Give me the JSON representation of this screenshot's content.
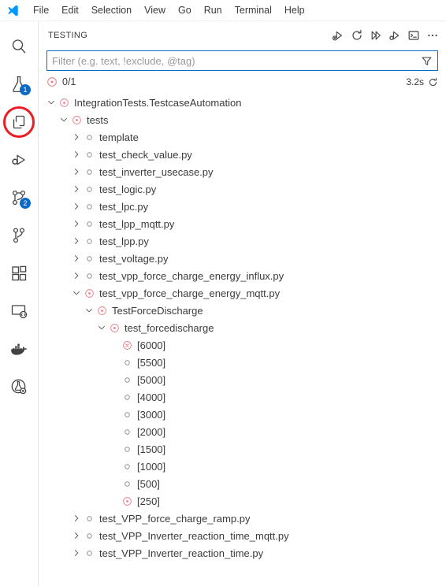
{
  "menubar": {
    "logo_icon": "vscode-logo",
    "items": [
      {
        "label": "File"
      },
      {
        "label": "Edit"
      },
      {
        "label": "Selection"
      },
      {
        "label": "View"
      },
      {
        "label": "Go"
      },
      {
        "label": "Run"
      },
      {
        "label": "Terminal"
      },
      {
        "label": "Help"
      }
    ]
  },
  "activitybar": {
    "items": [
      {
        "icon": "search-icon",
        "badge": null,
        "annotated": false
      },
      {
        "icon": "testing-flask-icon",
        "badge": "1",
        "annotated": false
      },
      {
        "icon": "copy-files-icon",
        "badge": null,
        "annotated": true
      },
      {
        "icon": "run-and-debug-icon",
        "badge": null,
        "annotated": false
      },
      {
        "icon": "source-control-icon",
        "badge": "2",
        "annotated": false
      },
      {
        "icon": "branch-icon",
        "badge": null,
        "annotated": false
      },
      {
        "icon": "extensions-icon",
        "badge": null,
        "annotated": false
      },
      {
        "icon": "remote-explorer-icon",
        "badge": null,
        "annotated": false
      },
      {
        "icon": "docker-icon",
        "badge": null,
        "annotated": false
      },
      {
        "icon": "test-lab-icon",
        "badge": null,
        "annotated": false
      }
    ],
    "annotation_color": "#ee1c25",
    "badge_color": "#0c6ac7"
  },
  "panel": {
    "title": "TESTING",
    "actions": [
      {
        "icon": "run-with-coverage-icon",
        "title": "Run Tests with Coverage"
      },
      {
        "icon": "refresh-icon",
        "title": "Refresh Tests"
      },
      {
        "icon": "run-all-tests-icon",
        "title": "Run All Tests"
      },
      {
        "icon": "debug-all-tests-icon",
        "title": "Debug All Tests"
      },
      {
        "icon": "show-output-icon",
        "title": "Show Output"
      },
      {
        "icon": "more-actions-icon",
        "title": "Views and More Actions..."
      }
    ]
  },
  "filter": {
    "placeholder": "Filter (e.g. text, !exclude, @tag)",
    "value": "",
    "icon": "filter-funnel-icon",
    "border_color": "#0c6ac7"
  },
  "status": {
    "state_icon": "queued-icon",
    "count": "0/1",
    "duration": "3.2s",
    "spinner_icon": "refresh-spinner-icon"
  },
  "colors": {
    "queued": "#e8818a",
    "failed": "#e8818a",
    "unset": "#8c8c8c",
    "text": "#3b3b3b",
    "accent": "#0c6ac7"
  },
  "tree": {
    "rows": [
      {
        "label": "IntegrationTests.TestcaseAutomation",
        "depth": 0,
        "twisty": "down",
        "state": "queued"
      },
      {
        "label": "tests",
        "depth": 1,
        "twisty": "down",
        "state": "queued"
      },
      {
        "label": "template",
        "depth": 2,
        "twisty": "right",
        "state": "unset"
      },
      {
        "label": "test_check_value.py",
        "depth": 2,
        "twisty": "right",
        "state": "unset"
      },
      {
        "label": "test_inverter_usecase.py",
        "depth": 2,
        "twisty": "right",
        "state": "unset"
      },
      {
        "label": "test_logic.py",
        "depth": 2,
        "twisty": "right",
        "state": "unset"
      },
      {
        "label": "test_lpc.py",
        "depth": 2,
        "twisty": "right",
        "state": "unset"
      },
      {
        "label": "test_lpp_mqtt.py",
        "depth": 2,
        "twisty": "right",
        "state": "unset"
      },
      {
        "label": "test_lpp.py",
        "depth": 2,
        "twisty": "right",
        "state": "unset"
      },
      {
        "label": "test_voltage.py",
        "depth": 2,
        "twisty": "right",
        "state": "unset"
      },
      {
        "label": "test_vpp_force_charge_energy_influx.py",
        "depth": 2,
        "twisty": "right",
        "state": "unset"
      },
      {
        "label": "test_vpp_force_charge_energy_mqtt.py",
        "depth": 2,
        "twisty": "down",
        "state": "queued"
      },
      {
        "label": "TestForceDischarge",
        "depth": 3,
        "twisty": "down",
        "state": "queued"
      },
      {
        "label": "test_forcedischarge",
        "depth": 4,
        "twisty": "down",
        "state": "queued"
      },
      {
        "label": "[6000]",
        "depth": 5,
        "twisty": "none",
        "state": "failed"
      },
      {
        "label": "[5500]",
        "depth": 5,
        "twisty": "none",
        "state": "unset"
      },
      {
        "label": "[5000]",
        "depth": 5,
        "twisty": "none",
        "state": "unset"
      },
      {
        "label": "[4000]",
        "depth": 5,
        "twisty": "none",
        "state": "unset"
      },
      {
        "label": "[3000]",
        "depth": 5,
        "twisty": "none",
        "state": "unset"
      },
      {
        "label": "[2000]",
        "depth": 5,
        "twisty": "none",
        "state": "unset"
      },
      {
        "label": "[1500]",
        "depth": 5,
        "twisty": "none",
        "state": "unset"
      },
      {
        "label": "[1000]",
        "depth": 5,
        "twisty": "none",
        "state": "unset"
      },
      {
        "label": "[500]",
        "depth": 5,
        "twisty": "none",
        "state": "unset"
      },
      {
        "label": "[250]",
        "depth": 5,
        "twisty": "none",
        "state": "queued"
      },
      {
        "label": "test_VPP_force_charge_ramp.py",
        "depth": 2,
        "twisty": "right",
        "state": "unset"
      },
      {
        "label": "test_VPP_Inverter_reaction_time_mqtt.py",
        "depth": 2,
        "twisty": "right",
        "state": "unset"
      },
      {
        "label": "test_VPP_Inverter_reaction_time.py",
        "depth": 2,
        "twisty": "right",
        "state": "unset"
      }
    ]
  }
}
